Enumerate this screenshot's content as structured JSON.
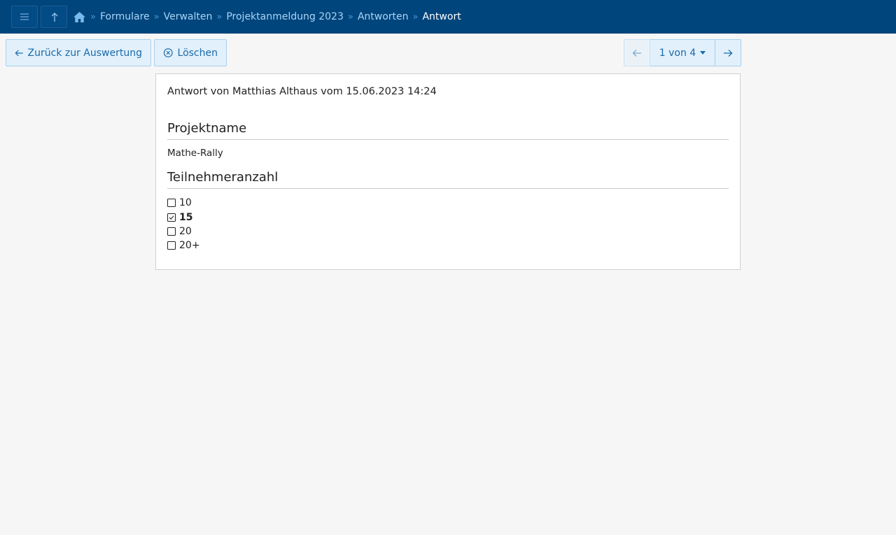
{
  "nav": {
    "menu_icon": "menu-icon",
    "up_icon": "up-arrow-icon",
    "home_icon": "home-icon",
    "breadcrumbs": [
      {
        "label": "Formulare"
      },
      {
        "label": "Verwalten"
      },
      {
        "label": "Projektanmeldung 2023"
      },
      {
        "label": "Antworten"
      }
    ],
    "current": "Antwort",
    "separator": "»"
  },
  "toolbar": {
    "back_label": "Zurück zur Auswertung",
    "delete_label": "Löschen",
    "pager_label": "1 von 4"
  },
  "response": {
    "meta": "Antwort von Matthias Althaus vom 15.06.2023 14:24",
    "sections": [
      {
        "title": "Projektname",
        "answer": "Mathe-Rally"
      },
      {
        "title": "Teilnehmeranzahl",
        "options": [
          {
            "label": "10",
            "checked": false
          },
          {
            "label": "15",
            "checked": true
          },
          {
            "label": "20",
            "checked": false
          },
          {
            "label": "20+",
            "checked": false
          }
        ]
      }
    ]
  },
  "colors": {
    "topbar": "#00457c",
    "accent": "#1a6aa8",
    "button_bg": "#e1f0fb",
    "background": "#f6f6f6"
  }
}
